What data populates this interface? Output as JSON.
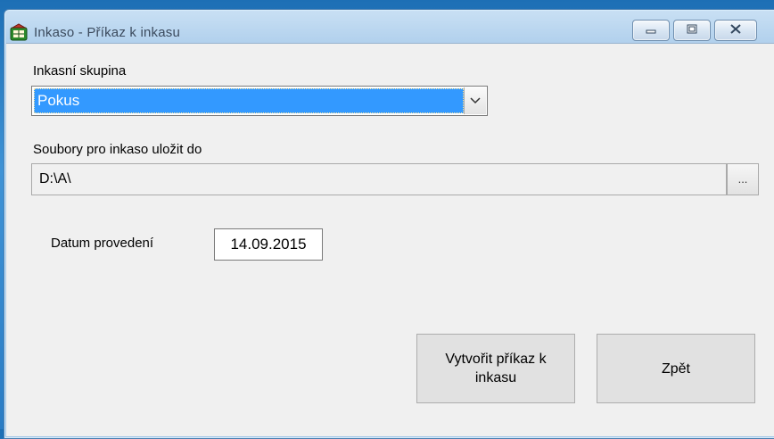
{
  "window": {
    "title": "Inkaso - Příkaz k inkasu",
    "controls": {
      "minimize_icon": "minimize-icon",
      "maximize_icon": "maximize-icon",
      "close_icon": "close-icon"
    }
  },
  "form": {
    "group_label": "Inkasní skupina",
    "group_value": "Pokus",
    "path_label": "Soubory pro inkaso uložit do",
    "path_value": "D:\\A\\",
    "browse_label": "...",
    "date_label": "Datum provedení",
    "date_value": "14.09.2015"
  },
  "buttons": {
    "create_line1": "Vytvořit příkaz k",
    "create_line2": "inkasu",
    "back": "Zpět"
  },
  "colors": {
    "selection": "#3399ff",
    "client_bg": "#f0f0f0",
    "desktop": "#2a7cc4"
  }
}
